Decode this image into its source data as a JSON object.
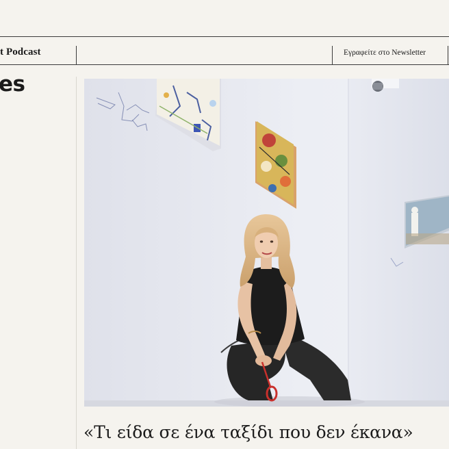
{
  "nav": {
    "podcast_label": "t Podcast",
    "newsletter_label": "Εγραφείτε στο Newsletter"
  },
  "section": {
    "title": "es"
  },
  "article": {
    "headline": "«Τι είδα σε ένα ταξίδι που δεν έκανα»"
  },
  "colors": {
    "background": "#f5f3ee",
    "rule": "#3a3a3a",
    "text": "#1b1b1b"
  }
}
